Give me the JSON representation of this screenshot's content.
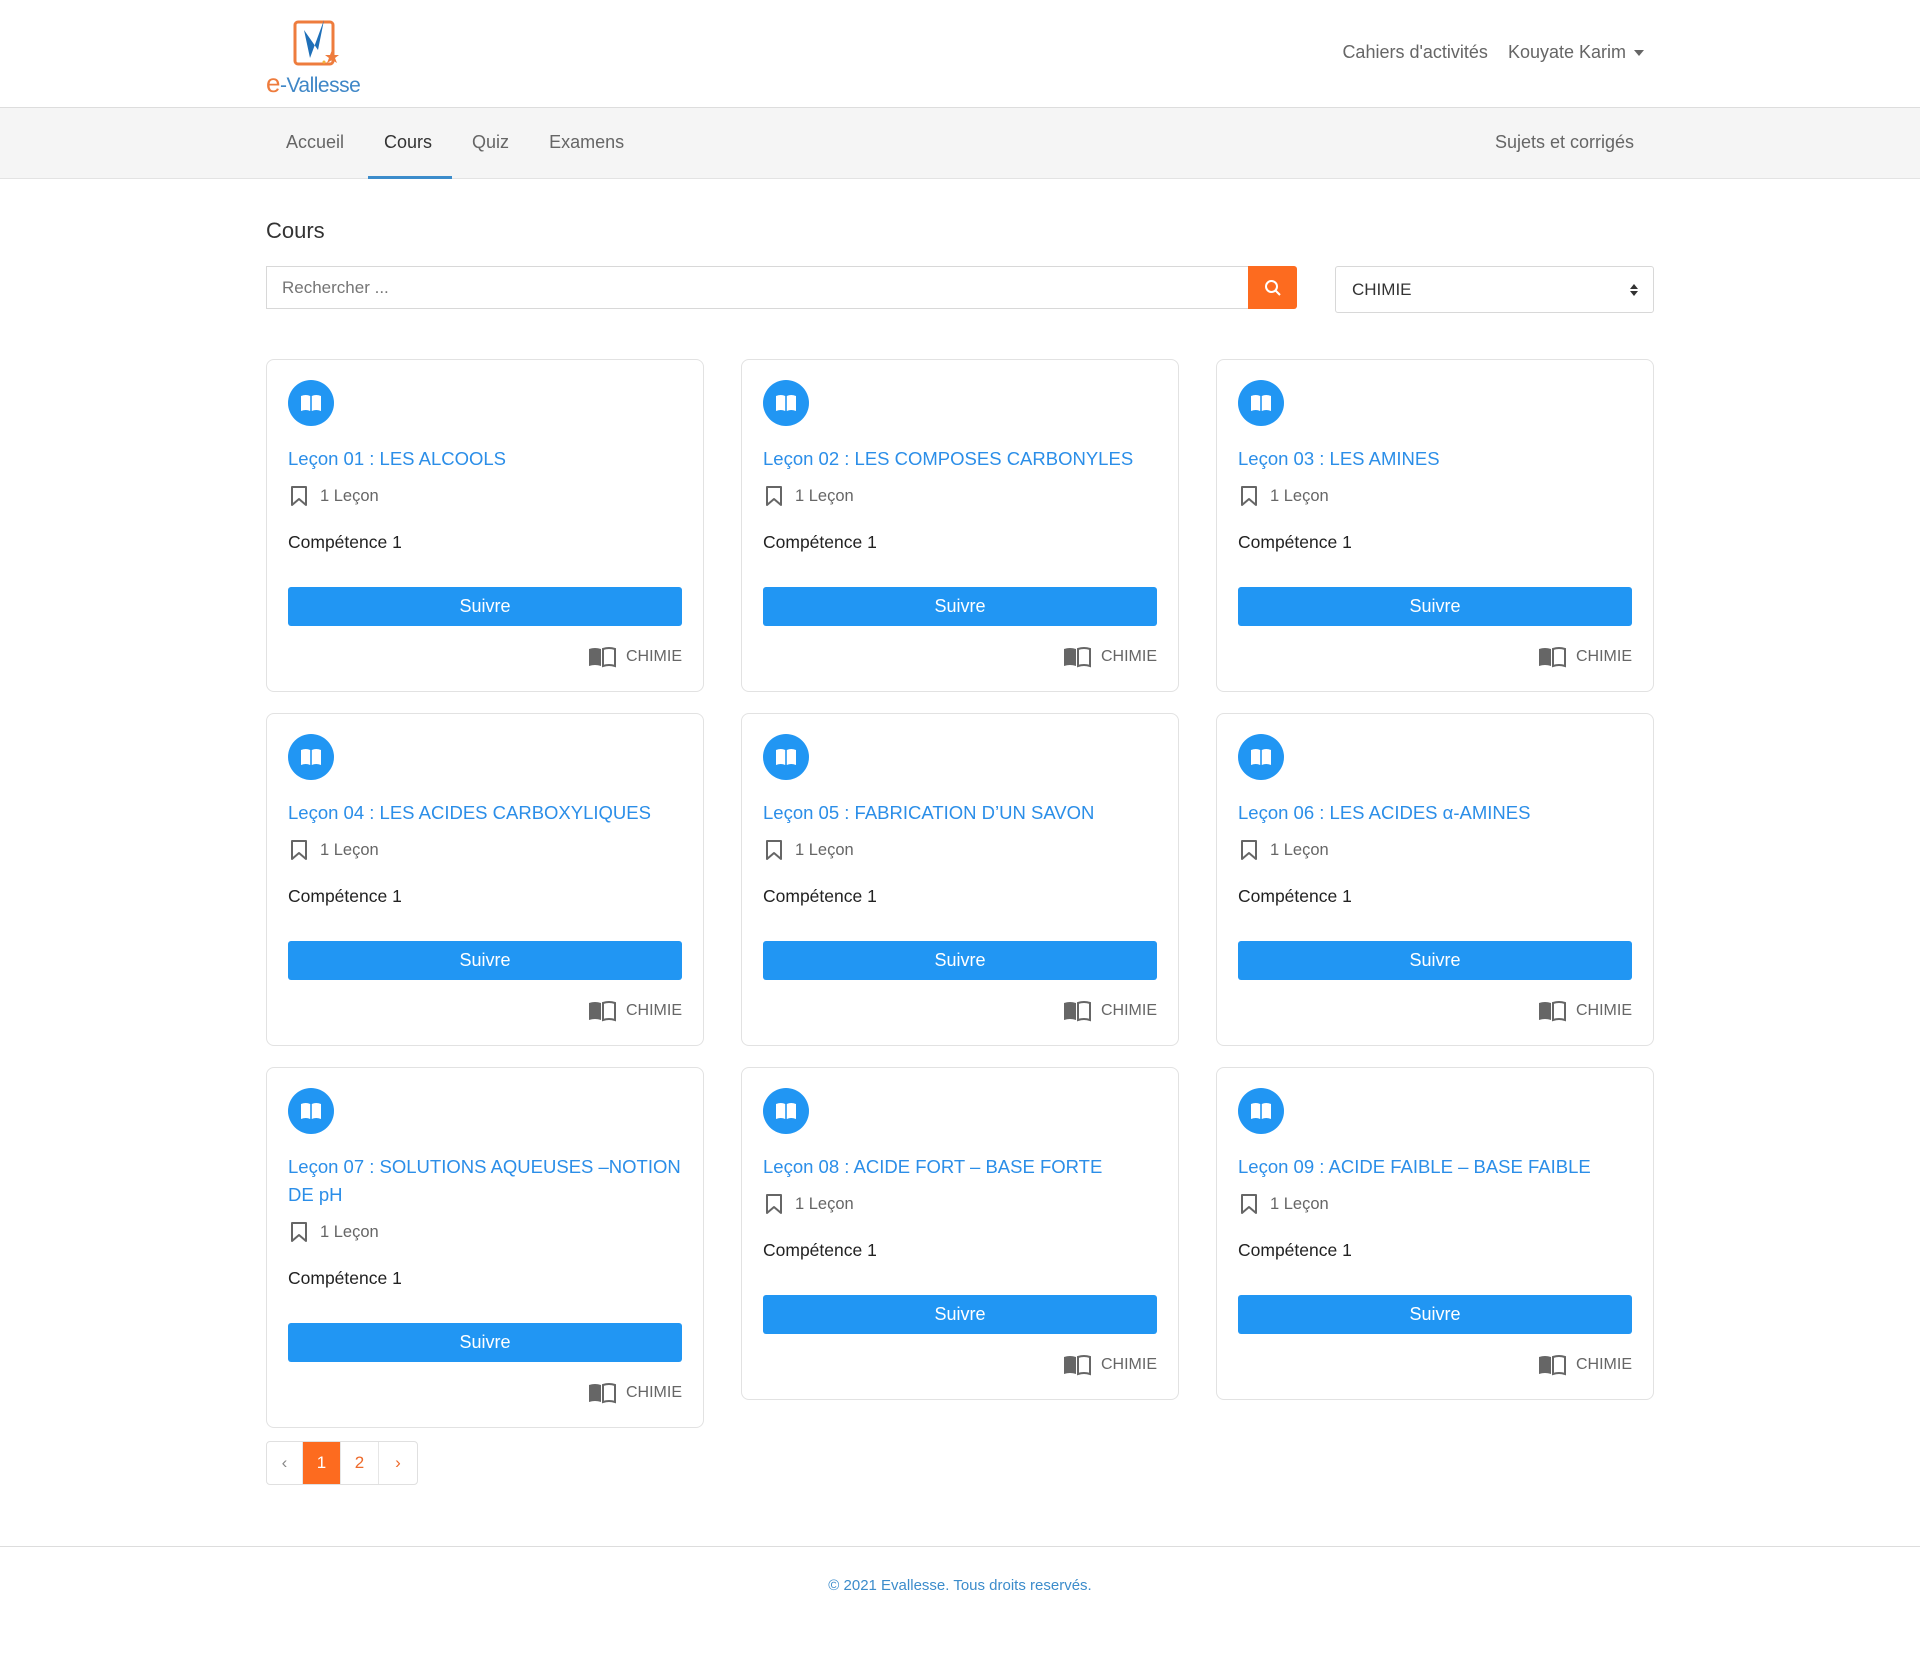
{
  "brand": {
    "logo_text_e": "e",
    "logo_text_rest": "-Vallesse"
  },
  "header": {
    "links": [
      {
        "label": "Cahiers d'activités"
      }
    ],
    "user": "Kouyate Karim"
  },
  "nav": {
    "items": [
      {
        "label": "Accueil"
      },
      {
        "label": "Cours",
        "active": true
      },
      {
        "label": "Quiz"
      },
      {
        "label": "Examens"
      }
    ],
    "right": "Sujets et corrigés"
  },
  "page": {
    "title": "Cours"
  },
  "search": {
    "placeholder": "Rechercher ...",
    "value": ""
  },
  "filter": {
    "selected": "CHIMIE"
  },
  "colors": {
    "accent": "#2196f3",
    "orange": "#fd6b1f",
    "link": "#2b8ee8"
  },
  "courses": [
    {
      "title": "Leçon 01 : LES ALCOOLS",
      "lessons": "1 Leçon",
      "competence": "Compétence 1",
      "button": "Suivre",
      "subject": "CHIMIE"
    },
    {
      "title": "Leçon 02 : LES COMPOSES CARBONYLES",
      "lessons": "1 Leçon",
      "competence": "Compétence 1",
      "button": "Suivre",
      "subject": "CHIMIE"
    },
    {
      "title": "Leçon 03 : LES AMINES",
      "lessons": "1 Leçon",
      "competence": "Compétence 1",
      "button": "Suivre",
      "subject": "CHIMIE"
    },
    {
      "title": "Leçon 04 : LES ACIDES CARBOXYLIQUES",
      "lessons": "1 Leçon",
      "competence": "Compétence 1",
      "button": "Suivre",
      "subject": "CHIMIE"
    },
    {
      "title": "Leçon 05 : FABRICATION D’UN SAVON",
      "lessons": "1 Leçon",
      "competence": "Compétence 1",
      "button": "Suivre",
      "subject": "CHIMIE"
    },
    {
      "title": "Leçon 06 : LES ACIDES α-AMINES",
      "lessons": "1 Leçon",
      "competence": "Compétence 1",
      "button": "Suivre",
      "subject": "CHIMIE"
    },
    {
      "title": "Leçon 07 : SOLUTIONS AQUEUSES –NOTION DE pH",
      "lessons": "1 Leçon",
      "competence": "Compétence 1",
      "button": "Suivre",
      "subject": "CHIMIE"
    },
    {
      "title": "Leçon 08 : ACIDE FORT – BASE FORTE",
      "lessons": "1 Leçon",
      "competence": "Compétence 1",
      "button": "Suivre",
      "subject": "CHIMIE"
    },
    {
      "title": "Leçon 09 : ACIDE FAIBLE – BASE FAIBLE",
      "lessons": "1 Leçon",
      "competence": "Compétence 1",
      "button": "Suivre",
      "subject": "CHIMIE"
    }
  ],
  "pagination": {
    "prev": "‹",
    "pages": [
      "1",
      "2"
    ],
    "current": "1",
    "next": "›"
  },
  "footer": {
    "text": "© 2021 Evallesse. Tous droits reservés."
  }
}
